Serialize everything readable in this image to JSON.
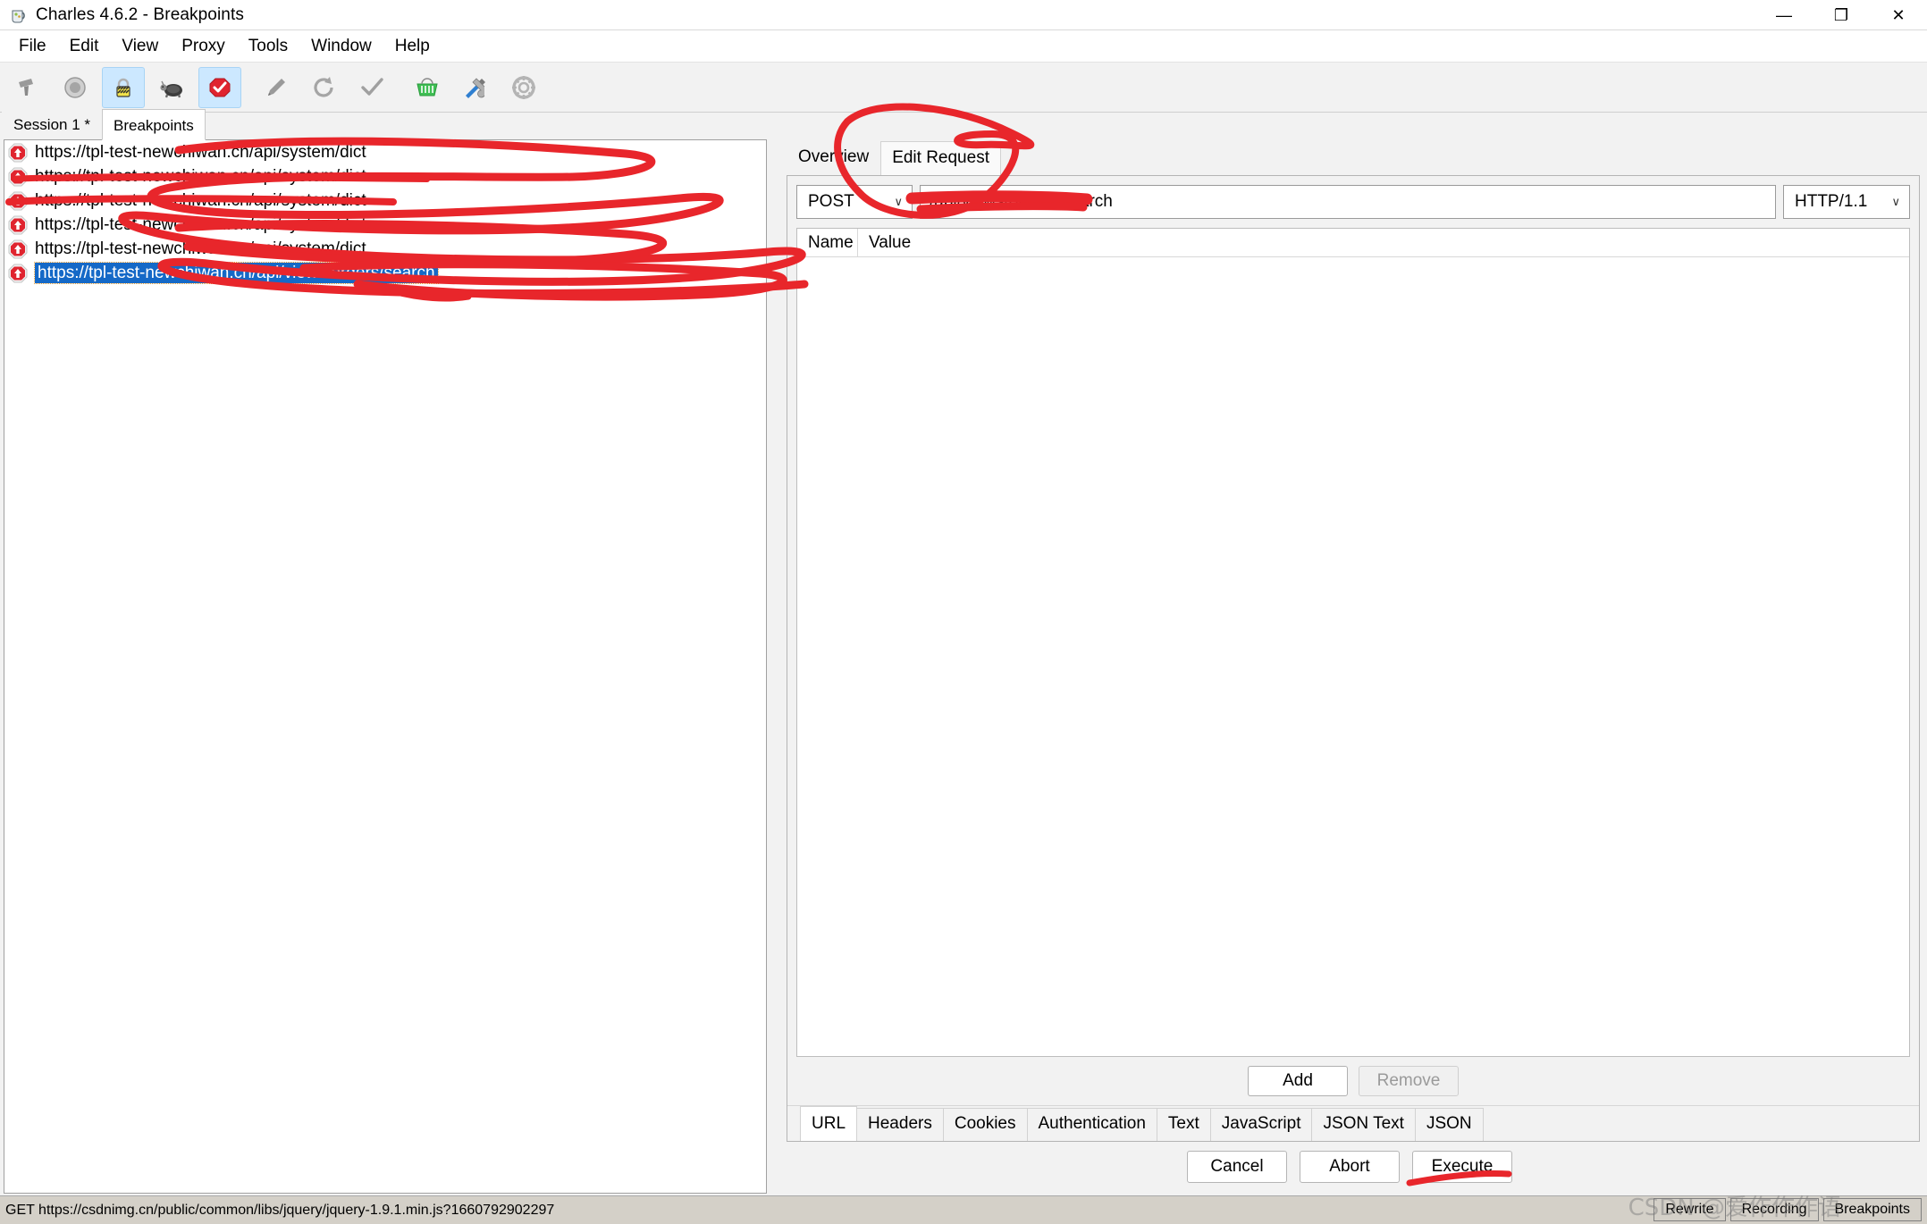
{
  "window": {
    "title": "Charles 4.6.2 - Breakpoints",
    "app_icon": "charles-jug-icon",
    "controls": [
      {
        "name": "minimize-button",
        "glyph": "—"
      },
      {
        "name": "restore-button",
        "glyph": "❐"
      },
      {
        "name": "close-button",
        "glyph": "✕"
      }
    ]
  },
  "menubar": {
    "items": [
      {
        "label": "File"
      },
      {
        "label": "Edit"
      },
      {
        "label": "View"
      },
      {
        "label": "Proxy"
      },
      {
        "label": "Tools"
      },
      {
        "label": "Window"
      },
      {
        "label": "Help"
      }
    ]
  },
  "toolbar": {
    "buttons": [
      {
        "icon": "clear-session-icon",
        "active": false
      },
      {
        "icon": "record-icon",
        "active": false
      },
      {
        "icon": "ssl-proxying-lock-icon",
        "active": true
      },
      {
        "icon": "throttle-turtle-icon",
        "active": false
      },
      {
        "icon": "breakpoints-stop-icon",
        "active": true
      },
      {
        "icon": "compose-pen-icon",
        "active": false
      },
      {
        "icon": "repeat-refresh-icon",
        "active": false
      },
      {
        "icon": "validate-check-icon",
        "active": false
      },
      {
        "icon": "basket-icon",
        "active": false
      },
      {
        "icon": "tools-icon",
        "active": false
      },
      {
        "icon": "settings-gear-icon",
        "active": false
      }
    ]
  },
  "session_tabs": {
    "items": [
      {
        "label": "Session 1 *",
        "selected": false
      },
      {
        "label": "Breakpoints",
        "selected": true
      }
    ]
  },
  "breakpoint_list": {
    "rows": [
      {
        "icon": "breakpoint-up-arrow-icon",
        "url": "https://tpl-test-newchiwan.cn/api/system/dict",
        "selected": false
      },
      {
        "icon": "breakpoint-up-arrow-icon",
        "url": "https://tpl-test-newchiwan.cn/api/system/dict",
        "selected": false
      },
      {
        "icon": "breakpoint-up-arrow-icon",
        "url": "https://tpl-test-newchiwan.cn/api/system/dict",
        "selected": false
      },
      {
        "icon": "breakpoint-up-arrow-icon",
        "url": "https://tpl-test-newchiwan.cn/api/system/dict",
        "selected": false
      },
      {
        "icon": "breakpoint-up-arrow-icon",
        "url": "https://tpl-test-newchiwan.cn/api/system/dict",
        "selected": false
      },
      {
        "icon": "breakpoint-up-arrow-icon",
        "url": "https://tpl-test-newchiwan.cn/api/views/orders/search",
        "selected": true
      }
    ]
  },
  "detail_tabs": {
    "items": [
      {
        "label": "Overview",
        "selected": false
      },
      {
        "label": "Edit Request",
        "selected": true
      }
    ]
  },
  "request": {
    "method": "POST",
    "method_caret": "∨",
    "url": "/api/views/orders/search",
    "protocol": "HTTP/1.1",
    "protocol_caret": "∨"
  },
  "param_table": {
    "columns": [
      "Name",
      "Value"
    ],
    "rows": []
  },
  "param_buttons": {
    "add": "Add",
    "remove": "Remove",
    "remove_disabled": true
  },
  "format_tabs": {
    "items": [
      {
        "label": "URL",
        "selected": true
      },
      {
        "label": "Headers",
        "selected": false
      },
      {
        "label": "Cookies",
        "selected": false
      },
      {
        "label": "Authentication",
        "selected": false
      },
      {
        "label": "Text",
        "selected": false
      },
      {
        "label": "JavaScript",
        "selected": false
      },
      {
        "label": "JSON Text",
        "selected": false
      },
      {
        "label": "JSON",
        "selected": false
      }
    ]
  },
  "actions": {
    "cancel": "Cancel",
    "abort": "Abort",
    "execute": "Execute"
  },
  "statusbar": {
    "text": "GET https://csdnimg.cn/public/common/libs/jquery/jquery-1.9.1.min.js?1660792902297",
    "rewrite": "Rewrite",
    "recording": "Recording",
    "breakpoints": "Breakpoints",
    "watermark": "CSDN @爱作作作语"
  },
  "colors": {
    "annotation_red": "#e8262b",
    "selection_blue": "#1569c7",
    "toolbar_active": "#cce8ff",
    "statusbar_bg": "#d4d0c8"
  }
}
